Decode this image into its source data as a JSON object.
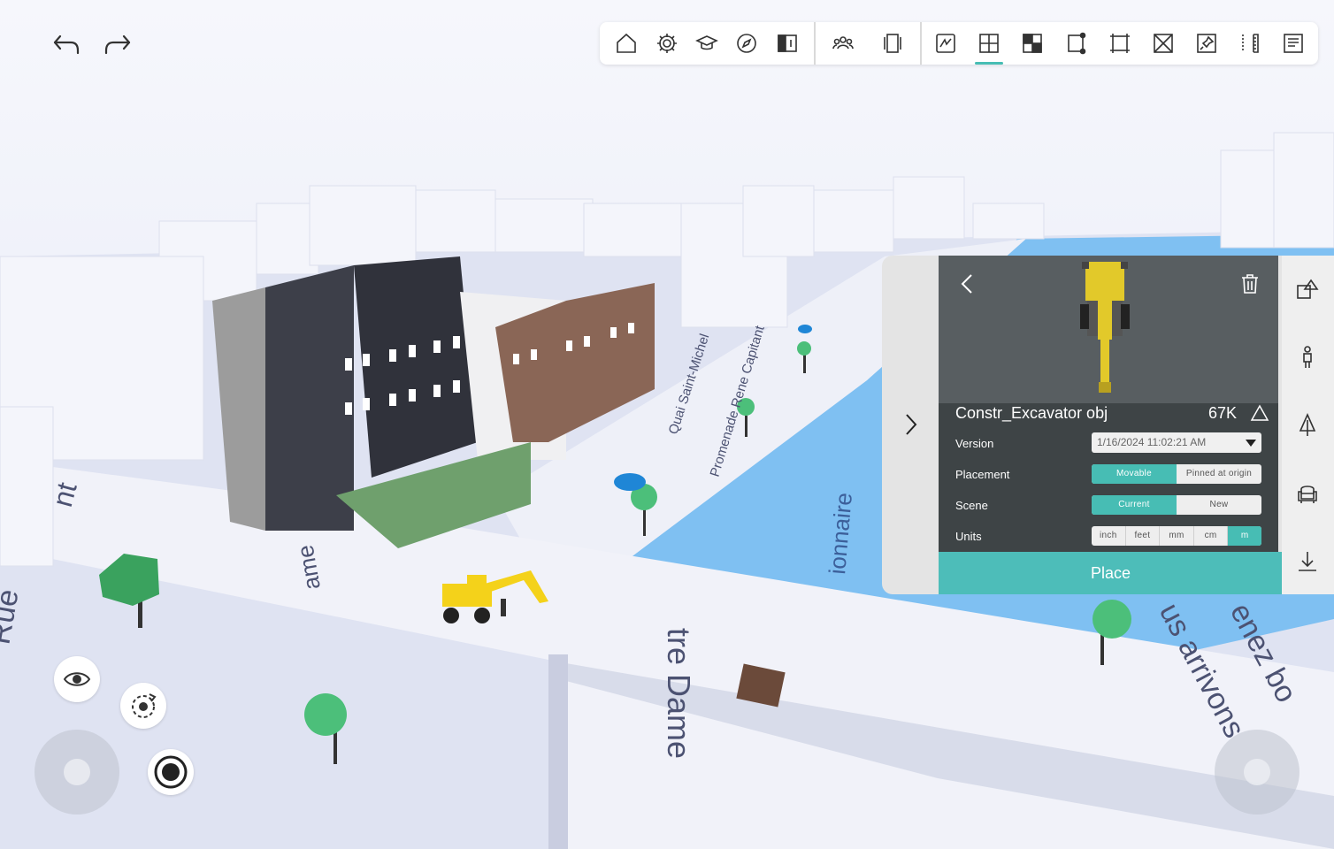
{
  "toolbar": {
    "history": [
      {
        "name": "undo",
        "icon": "undo-arrow-icon"
      },
      {
        "name": "redo",
        "icon": "redo-arrow-icon"
      }
    ],
    "active_tool": "floor-plan",
    "accent": "#47bdb4"
  },
  "panel": {
    "model_name": "Constr_Excavator obj",
    "poly_count": "67K",
    "version": {
      "label": "Version",
      "value": "1/16/2024 11:02:21 AM"
    },
    "placement": {
      "label": "Placement",
      "options": [
        "Movable",
        "Pinned at origin"
      ],
      "selected": "Movable"
    },
    "scene": {
      "label": "Scene",
      "options": [
        "Current",
        "New"
      ],
      "selected": "Current"
    },
    "units": {
      "label": "Units",
      "options": [
        "inch",
        "feet",
        "mm",
        "cm",
        "m"
      ],
      "selected": "m"
    },
    "place_label": "Place",
    "place_color": "#4dbdb9"
  },
  "scene_labels": {
    "street_1": "Quai Saint-Michel",
    "street_2": "Promenade Rene Capitant",
    "street_3": "ame",
    "street_4": "Rue",
    "street_5": "tre Dame",
    "street_6": "nt",
    "street_7": "ionnaire",
    "street_8": "us arrivons",
    "street_9": "enez bo"
  }
}
